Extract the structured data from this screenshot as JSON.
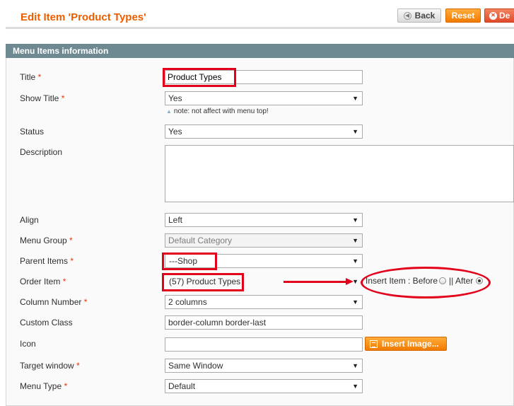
{
  "header": {
    "title": "Edit Item 'Product Types'",
    "back_label": "Back",
    "reset_label": "Reset",
    "delete_label": "De"
  },
  "section": {
    "title": "Menu Items information"
  },
  "form": {
    "title": {
      "label": "Title",
      "value": "Product Types"
    },
    "show_title": {
      "label": "Show Title",
      "value": "Yes",
      "note": "note: not affect with menu top!"
    },
    "status": {
      "label": "Status",
      "value": "Yes"
    },
    "description": {
      "label": "Description",
      "value": ""
    },
    "align": {
      "label": "Align",
      "value": "Left"
    },
    "menu_group": {
      "label": "Menu Group",
      "value": "Default Category"
    },
    "parent_items": {
      "label": "Parent Items",
      "value": "---Shop"
    },
    "order_item": {
      "label": "Order Item",
      "value": "(57) Product Types",
      "insert_label": "Insert Item : Before",
      "separator": "|| After",
      "insert_position": "After"
    },
    "column_number": {
      "label": "Column Number",
      "value": "2 columns"
    },
    "custom_class": {
      "label": "Custom Class",
      "value": "border-column border-last"
    },
    "icon": {
      "label": "Icon",
      "value": "",
      "button_label": "Insert Image..."
    },
    "target_window": {
      "label": "Target window",
      "value": "Same Window"
    },
    "menu_type": {
      "label": "Menu Type",
      "value": "Default"
    },
    "required_mark": "*"
  },
  "colors": {
    "accent": "#eb5e00",
    "section_header": "#6f8992",
    "annotation": "#e3001b"
  }
}
